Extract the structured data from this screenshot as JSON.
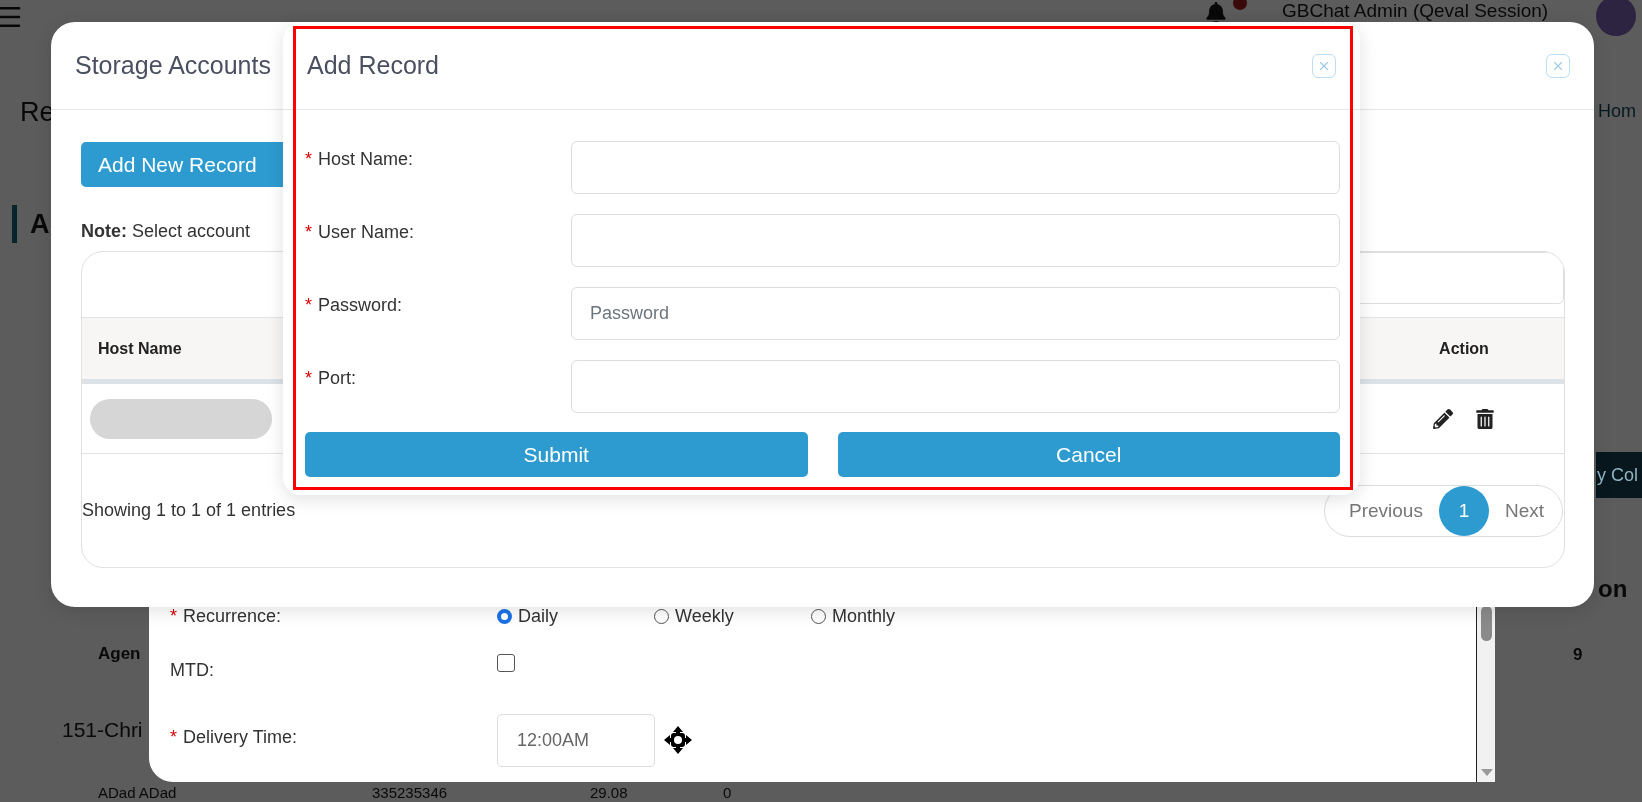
{
  "background_page": {
    "user_name": "GBChat Admin (Qeval Session)",
    "page_title": "Re",
    "section_title": "A",
    "breadcrumb_link": "Hom",
    "columns_button": "y Col",
    "table_header_fragments": [
      {
        "text": "on"
      },
      {
        "text": "Agen"
      },
      {
        "text": "9"
      }
    ],
    "rows": [
      {
        "cells": [
          "151-Chri"
        ]
      },
      {
        "cells": [
          "ADad ADad",
          "335235346",
          "29.08",
          "0"
        ]
      }
    ]
  },
  "schedule_form": {
    "fields": [
      {
        "kind": "radio",
        "required_mark": "*",
        "label": "Recurrence:",
        "options": [
          {
            "label": "Daily",
            "selected": true
          },
          {
            "label": "Weekly",
            "selected": false
          },
          {
            "label": "Monthly",
            "selected": false
          }
        ]
      },
      {
        "kind": "checkbox",
        "label": "MTD:",
        "checked": false
      },
      {
        "kind": "time",
        "required_mark": "*",
        "label": "Delivery Time:",
        "value": "12:00AM"
      }
    ]
  },
  "storage_dialog": {
    "title": "Storage Accounts",
    "add_button": "Add New Record",
    "note": "**Note:** Select account",
    "table": {
      "columns": [
        "Host Name",
        "Action"
      ],
      "rows": [
        {
          "kind": "loading"
        }
      ]
    },
    "info": "Showing 1 to 1 of 1 entries",
    "pagination": {
      "previous": "Previous",
      "pages": [
        {
          "label": "1",
          "selected": true
        }
      ],
      "next": "Next"
    }
  },
  "add_record_dialog": {
    "title": "Add Record",
    "highlighted": true,
    "fields": [
      {
        "required_mark": "*",
        "label": "Host Name:"
      },
      {
        "required_mark": "*",
        "label": "User Name:"
      },
      {
        "required_mark": "*",
        "label": "Password:",
        "placeholder": "Password"
      },
      {
        "required_mark": "*",
        "label": "Port:"
      }
    ],
    "buttons": [
      "Submit",
      "Cancel"
    ]
  }
}
